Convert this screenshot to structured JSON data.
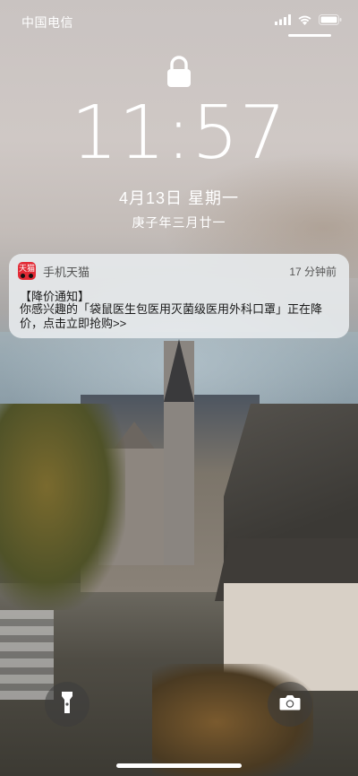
{
  "status_bar": {
    "carrier": "中国电信",
    "signal_icon": "cellular-signal-icon",
    "wifi_icon": "wifi-icon",
    "battery_icon": "battery-icon"
  },
  "lock_screen": {
    "lock_icon": "padlock-icon",
    "time": "11:57",
    "date": "4月13日 星期一",
    "lunar_date": "庚子年三月廿一"
  },
  "notification": {
    "app_icon_label": "天猫",
    "app_name": "手机天猫",
    "time_ago": "17 分钟前",
    "title": "【降价通知】",
    "body": "你感兴趣的「袋鼠医生包医用灭菌级医用外科口罩」正在降价，点击立即抢购>>"
  },
  "quick_actions": {
    "flashlight_icon": "flashlight-icon",
    "camera_icon": "camera-icon"
  },
  "colors": {
    "notification_bg": "#E8ECEE",
    "tmall_red": "#E22A35",
    "text_white": "#FFFFFF"
  }
}
